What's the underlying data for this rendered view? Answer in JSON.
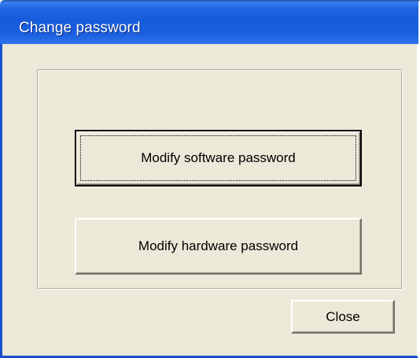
{
  "window": {
    "title": "Change password"
  },
  "buttons": {
    "modify_software": "Modify software password",
    "modify_hardware": "Modify hardware password",
    "close": "Close"
  },
  "colors": {
    "titlebar_blue": "#165bdb",
    "dialog_face": "#ece9d8",
    "title_text": "#ffffff"
  }
}
